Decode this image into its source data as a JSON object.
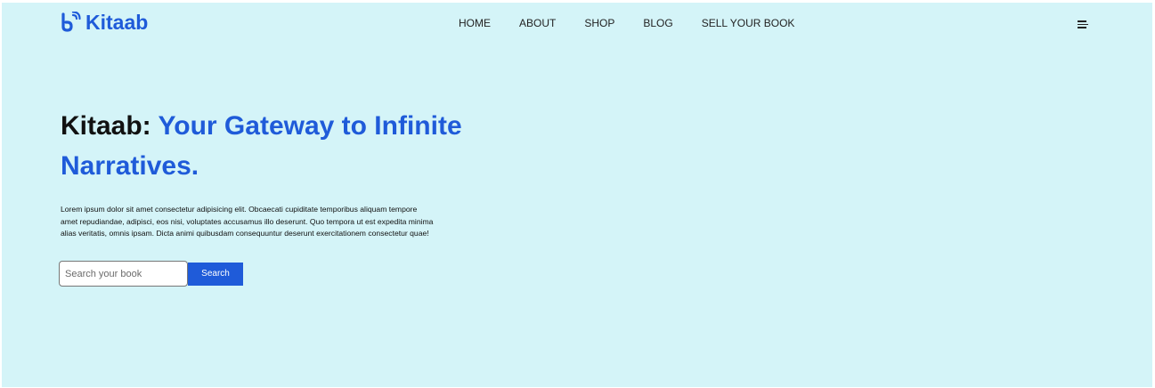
{
  "brand": {
    "name": "Kitaab",
    "icon": "book-signal-icon",
    "color": "#1f5bd9"
  },
  "nav": {
    "items": [
      {
        "label": "HOME"
      },
      {
        "label": "ABOUT"
      },
      {
        "label": "SHOP"
      },
      {
        "label": "BLOG"
      },
      {
        "label": "SELL YOUR BOOK"
      }
    ],
    "menu_icon": "hamburger-menu-icon"
  },
  "hero": {
    "title_brand": "Kitaab:",
    "title_line1": "Your Gateway to Infinite",
    "title_line2": "Narratives.",
    "description_lines": [
      "Lorem ipsum dolor sit amet consectetur adipisicing elit. Obcaecati cupiditate temporibus aliquam tempore",
      "amet repudiandae, adipisci, eos nisi, voluptates accusamus illo deserunt. Quo tempora ut est expedita minima",
      "alias veritatis, omnis ipsam. Dicta animi quibusdam consequuntur deserunt exercitationem consectetur quae!"
    ]
  },
  "search": {
    "placeholder": "Search your book",
    "value": "",
    "button_label": "Search"
  },
  "colors": {
    "background": "#d4f4f8",
    "accent": "#1f5bd9",
    "text": "#111111"
  }
}
